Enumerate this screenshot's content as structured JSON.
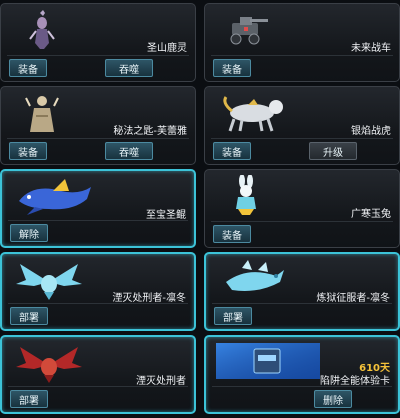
{
  "cards": [
    {
      "name": "圣山鹿灵",
      "extra": "",
      "btn1": "装备",
      "btn2": "吞噬",
      "selected": false,
      "icon": "deer-spirit-icon"
    },
    {
      "name": "未来战车",
      "extra": "",
      "btn1": "装备",
      "btn2": "",
      "selected": false,
      "icon": "mech-tank-icon"
    },
    {
      "name": "秘法之匙-芙蕾雅",
      "extra": "",
      "btn1": "装备",
      "btn2": "吞噬",
      "selected": false,
      "icon": "sorceress-icon"
    },
    {
      "name": "银焰战虎",
      "extra": "",
      "btn1": "装备",
      "btn2": "升级",
      "selected": false,
      "icon": "silver-tiger-icon"
    },
    {
      "name": "至宝圣鲲",
      "extra": "",
      "btn1": "解除",
      "btn2": "",
      "selected": true,
      "icon": "sacred-whale-icon"
    },
    {
      "name": "广寒玉兔",
      "extra": "",
      "btn1": "装备",
      "btn2": "",
      "selected": false,
      "icon": "jade-rabbit-icon"
    },
    {
      "name": "湮灭处刑者-凛冬",
      "extra": "",
      "btn1": "部署",
      "btn2": "",
      "selected": true,
      "icon": "ice-dragon-icon"
    },
    {
      "name": "炼狱征服者-凛冬",
      "extra": "",
      "btn1": "部署",
      "btn2": "",
      "selected": true,
      "icon": "ice-beast-icon"
    },
    {
      "name": "湮灭处刑者",
      "extra": "",
      "btn1": "部署",
      "btn2": "",
      "selected": true,
      "icon": "fire-dragon-icon"
    },
    {
      "name": "陷阱全能体验卡",
      "extra": "610天",
      "btn1": "删除",
      "btn2": "",
      "selected": true,
      "icon": "trap-card-icon"
    }
  ]
}
